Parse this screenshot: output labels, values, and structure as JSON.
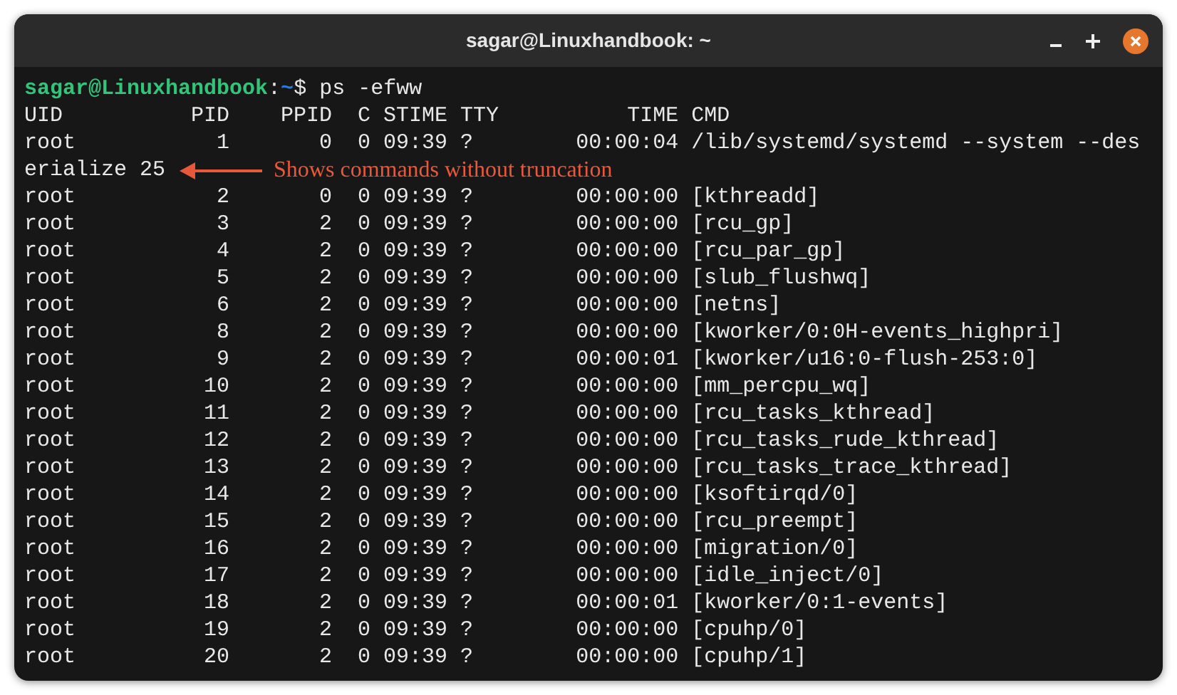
{
  "window": {
    "title": "sagar@Linuxhandbook: ~"
  },
  "prompt": {
    "user_host": "sagar@Linuxhandbook",
    "separator": ":",
    "path": "~",
    "symbol": "$",
    "command": " ps -efww"
  },
  "output_lines": [
    {
      "text": "UID          PID    PPID  C STIME TTY          TIME CMD"
    },
    {
      "text": "root           1       0  0 09:39 ?        00:00:04 /lib/systemd/systemd --system --des"
    },
    {
      "text": "erialize 25",
      "annotation": "Shows commands without truncation"
    },
    {
      "text": "root           2       0  0 09:39 ?        00:00:00 [kthreadd]"
    },
    {
      "text": "root           3       2  0 09:39 ?        00:00:00 [rcu_gp]"
    },
    {
      "text": "root           4       2  0 09:39 ?        00:00:00 [rcu_par_gp]"
    },
    {
      "text": "root           5       2  0 09:39 ?        00:00:00 [slub_flushwq]"
    },
    {
      "text": "root           6       2  0 09:39 ?        00:00:00 [netns]"
    },
    {
      "text": "root           8       2  0 09:39 ?        00:00:00 [kworker/0:0H-events_highpri]"
    },
    {
      "text": "root           9       2  0 09:39 ?        00:00:01 [kworker/u16:0-flush-253:0]"
    },
    {
      "text": "root          10       2  0 09:39 ?        00:00:00 [mm_percpu_wq]"
    },
    {
      "text": "root          11       2  0 09:39 ?        00:00:00 [rcu_tasks_kthread]"
    },
    {
      "text": "root          12       2  0 09:39 ?        00:00:00 [rcu_tasks_rude_kthread]"
    },
    {
      "text": "root          13       2  0 09:39 ?        00:00:00 [rcu_tasks_trace_kthread]"
    },
    {
      "text": "root          14       2  0 09:39 ?        00:00:00 [ksoftirqd/0]"
    },
    {
      "text": "root          15       2  0 09:39 ?        00:00:00 [rcu_preempt]"
    },
    {
      "text": "root          16       2  0 09:39 ?        00:00:00 [migration/0]"
    },
    {
      "text": "root          17       2  0 09:39 ?        00:00:00 [idle_inject/0]"
    },
    {
      "text": "root          18       2  0 09:39 ?        00:00:01 [kworker/0:1-events]"
    },
    {
      "text": "root          19       2  0 09:39 ?        00:00:00 [cpuhp/0]"
    },
    {
      "text": "root          20       2  0 09:39 ?        00:00:00 [cpuhp/1]"
    }
  ]
}
